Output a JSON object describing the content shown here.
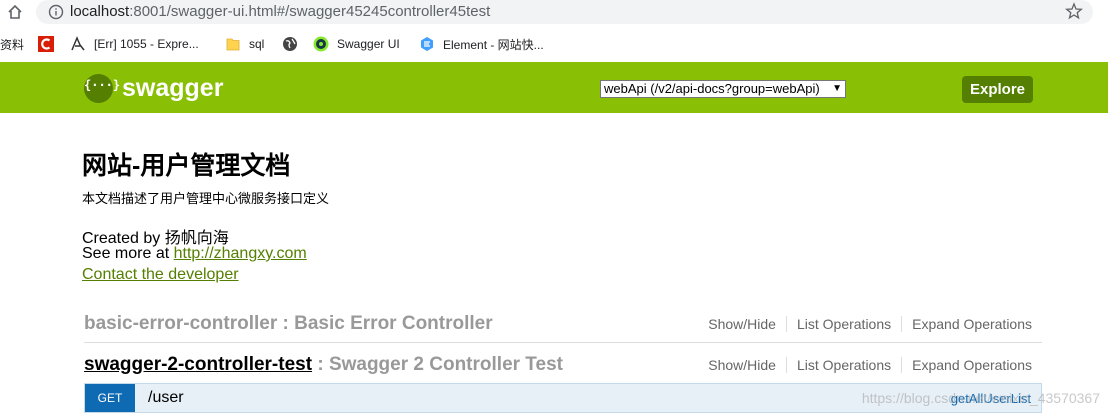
{
  "browser": {
    "url_host": "localhost",
    "url_path": ":8001/swagger-ui.html#/swagger45245controller45test"
  },
  "bookmarks": [
    {
      "label": "资料",
      "icon": "none"
    },
    {
      "label": "",
      "icon": "red-c-logo-icon"
    },
    {
      "label": "[Err] 1055 - Expre...",
      "icon": "a-logo-icon"
    },
    {
      "label": "sql",
      "icon": "folder-icon"
    },
    {
      "label": "",
      "icon": "globe-icon"
    },
    {
      "label": "Swagger UI",
      "icon": "swagger-icon"
    },
    {
      "label": "Element - 网站快...",
      "icon": "element-icon"
    }
  ],
  "header": {
    "brand": "swagger",
    "logo_glyph": "{···}",
    "api_select_value": "webApi (/v2/api-docs?group=webApi)",
    "explore_label": "Explore",
    "bg_color": "#89bf04"
  },
  "info": {
    "title": "网站-用户管理文档",
    "description": "本文档描述了用户管理中心微服务接口定义",
    "created_by": "Created by 扬帆向海",
    "see_more_prefix": "See more at ",
    "see_more_link": "http://zhangxy.com",
    "contact_link": "Contact the developer"
  },
  "resources": [
    {
      "name": "basic-error-controller",
      "separator": " : ",
      "description": "Basic Error Controller",
      "ops": [
        "Show/Hide",
        "List Operations",
        "Expand Operations"
      ]
    },
    {
      "name": "swagger-2-controller-test",
      "separator": " : ",
      "description": "Swagger 2 Controller Test",
      "ops": [
        "Show/Hide",
        "List Operations",
        "Expand Operations"
      ]
    }
  ],
  "operation": {
    "method": "GET",
    "path": "/user",
    "summary": "getAllUserList"
  },
  "watermark": "https://blog.csdn.net/weixin_43570367"
}
